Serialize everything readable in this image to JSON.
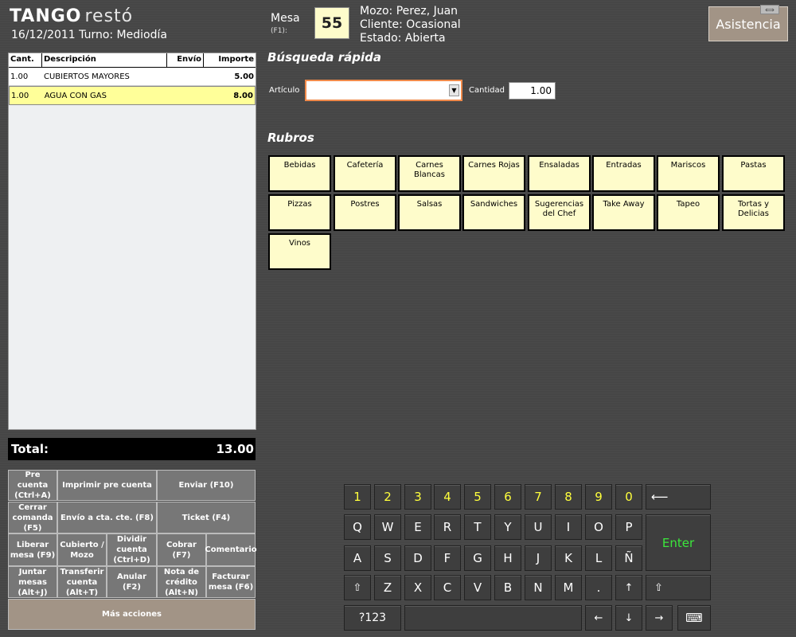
{
  "header": {
    "brand": "TANGO",
    "brand_suffix": "restó",
    "date_turno": "16/12/2011 Turno: Mediodía",
    "mesa_label": "Mesa",
    "mesa_key": "(F1):",
    "mesa_number": "55",
    "mozo": "Mozo: Perez, Juan",
    "cliente": "Cliente: Ocasional",
    "estado": "Estado: Abierta",
    "asistencia": "Asistencia"
  },
  "order": {
    "columns": [
      "Cant.",
      "Descripción",
      "Envío",
      "Importe"
    ],
    "rows": [
      {
        "cant": "1.00",
        "desc": "CUBIERTOS MAYORES",
        "envio": "",
        "importe": "5.00",
        "selected": false
      },
      {
        "cant": "1.00",
        "desc": "AGUA CON GAS",
        "envio": "",
        "importe": "8.00",
        "selected": true
      }
    ],
    "total_label": "Total:",
    "total_value": "13.00"
  },
  "actions": {
    "pre_cuenta": "Pre cuenta (Ctrl+A)",
    "imprimir_pre_cuenta": "Imprimir pre cuenta",
    "enviar": "Enviar (F10)",
    "cerrar_comanda": "Cerrar comanda (F5)",
    "envio_cta": "Envío a cta. cte. (F8)",
    "ticket": "Ticket (F4)",
    "liberar_mesa": "Liberar mesa (F9)",
    "cubierto_mozo": "Cubierto / Mozo",
    "dividir_cuenta": "Dividir cuenta (Ctrl+D)",
    "cobrar": "Cobrar (F7)",
    "comentario": "Comentario",
    "juntar_mesas": "Juntar mesas (Alt+J)",
    "transferir_cuenta": "Transferir cuenta (Alt+T)",
    "anular": "Anular (F2)",
    "nota_credito": "Nota de crédito (Alt+N)",
    "facturar_mesa": "Facturar mesa (F6)",
    "mas_acciones": "Más acciones"
  },
  "search": {
    "title": "Búsqueda rápida",
    "articulo_label": "Artículo",
    "articulo_value": "",
    "cantidad_label": "Cantidad",
    "cantidad_value": "1.00"
  },
  "rubros": {
    "title": "Rubros",
    "items": [
      "Bebidas",
      "Cafetería",
      "Carnes Blancas",
      "Carnes Rojas",
      "Ensaladas",
      "Entradas",
      "Mariscos",
      "Pastas",
      "Pizzas",
      "Postres",
      "Salsas",
      "Sandwiches",
      "Sugerencias del Chef",
      "Take Away",
      "Tapeo",
      "Tortas y Delicias",
      "Vinos"
    ]
  },
  "keyboard": {
    "row1": [
      "1",
      "2",
      "3",
      "4",
      "5",
      "6",
      "7",
      "8",
      "9",
      "0"
    ],
    "backspace": "⟵",
    "row2": [
      "Q",
      "W",
      "E",
      "R",
      "T",
      "Y",
      "U",
      "I",
      "O",
      "P"
    ],
    "enter": "Enter",
    "row3": [
      "A",
      "S",
      "D",
      "F",
      "G",
      "H",
      "J",
      "K",
      "L",
      "Ñ"
    ],
    "shift": "⇧",
    "row4": [
      "Z",
      "X",
      "C",
      "V",
      "B",
      "N",
      "M",
      "."
    ],
    "up": "↑",
    "shift_right": "⇧",
    "symbols": "?123",
    "space": "",
    "left": "←",
    "down": "↓",
    "right": "→",
    "keyboard_icon": "⌨"
  }
}
